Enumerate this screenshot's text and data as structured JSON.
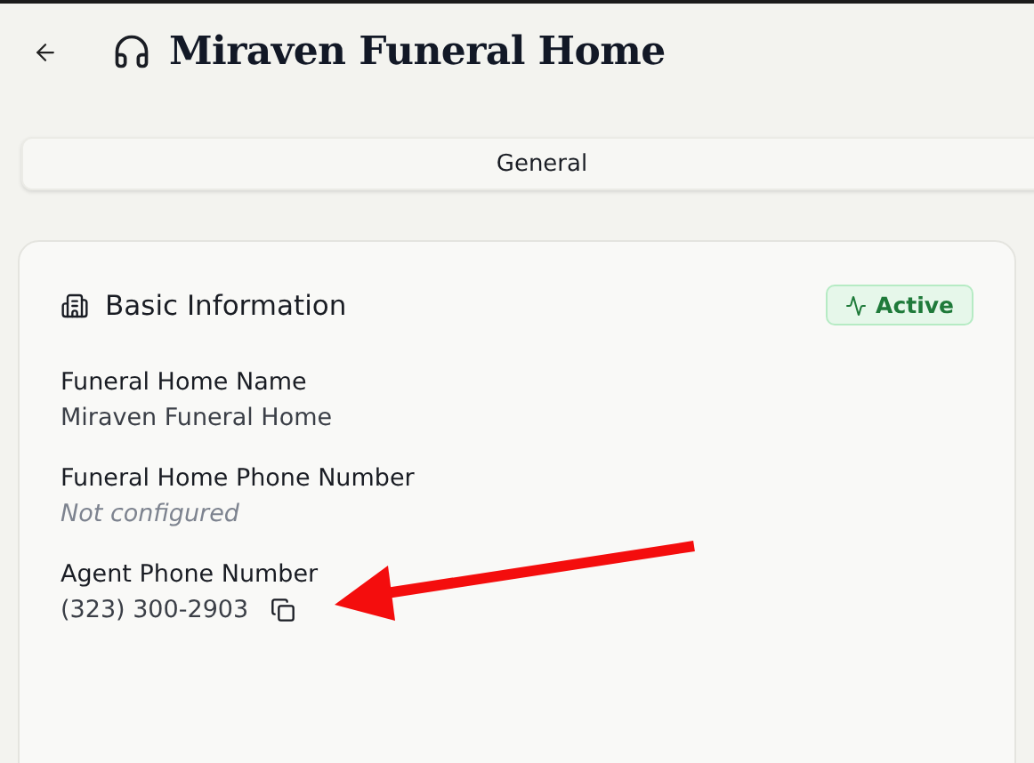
{
  "header": {
    "title": "Miraven Funeral Home"
  },
  "tabs": [
    {
      "label": "General",
      "selected": true
    }
  ],
  "card": {
    "title": "Basic Information",
    "status": {
      "label": "Active",
      "active": true
    },
    "fields": [
      {
        "label": "Funeral Home Name",
        "value": "Miraven Funeral Home",
        "configured": true,
        "copyable": false
      },
      {
        "label": "Funeral Home Phone Number",
        "value": "Not configured",
        "configured": false,
        "copyable": false
      },
      {
        "label": "Agent Phone Number",
        "value": "(323) 300-2903",
        "configured": true,
        "copyable": true
      }
    ]
  }
}
